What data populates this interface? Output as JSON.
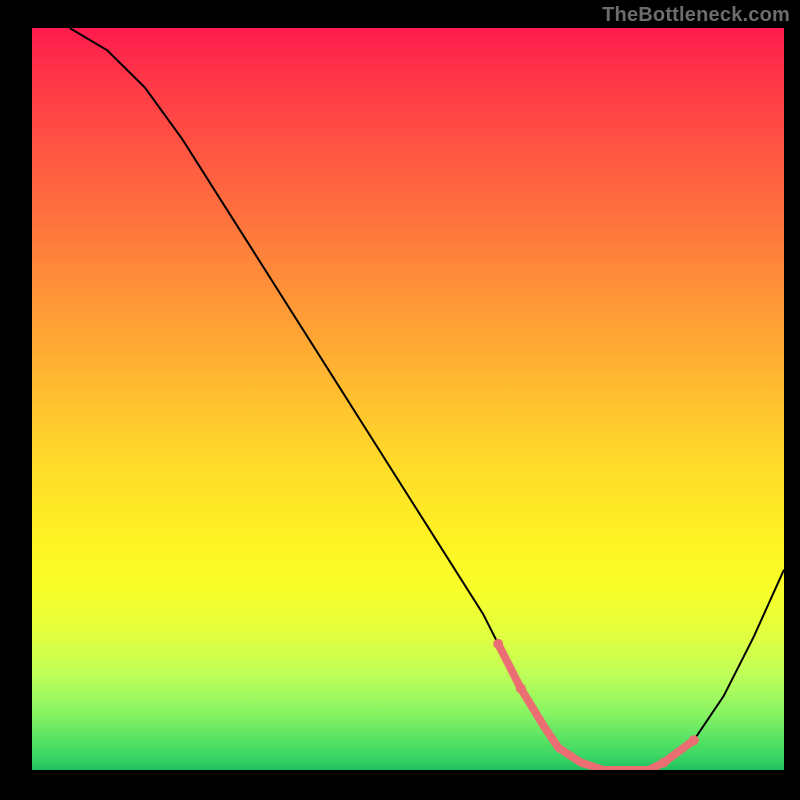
{
  "attribution": "TheBottleneck.com",
  "colors": {
    "frame": "#000000",
    "curve": "#000000",
    "markers": "#eb6e72",
    "gradient_top": "#ff1a4d",
    "gradient_bottom": "#1fc060"
  },
  "chart_data": {
    "type": "line",
    "title": "",
    "xlabel": "",
    "ylabel": "",
    "xlim": [
      0,
      100
    ],
    "ylim": [
      0,
      100
    ],
    "grid": false,
    "legend": false,
    "series": [
      {
        "name": "bottleneck-curve",
        "x": [
          5,
          10,
          15,
          20,
          25,
          30,
          35,
          40,
          45,
          50,
          55,
          60,
          62,
          65,
          68,
          70,
          73,
          76,
          79,
          82,
          84,
          88,
          92,
          96,
          100
        ],
        "y": [
          100,
          97,
          92,
          85,
          77,
          69,
          61,
          53,
          45,
          37,
          29,
          21,
          17,
          11,
          6,
          3,
          1,
          0,
          0,
          0,
          1,
          4,
          10,
          18,
          27
        ]
      }
    ],
    "marker_region": {
      "name": "optimal-range",
      "x": [
        62,
        65,
        68,
        70,
        73,
        76,
        79,
        82,
        84,
        88
      ],
      "y": [
        17,
        11,
        6,
        3,
        1,
        0,
        0,
        0,
        1,
        4
      ]
    },
    "background": "rainbow-vertical"
  }
}
